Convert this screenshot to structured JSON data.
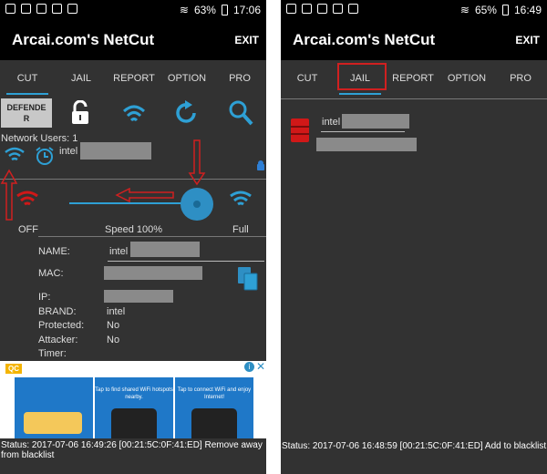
{
  "left": {
    "status_bar": {
      "battery": "63%",
      "time": "17:06"
    },
    "app_title": "Arcai.com's NetCut",
    "exit_label": "EXIT",
    "tabs": [
      "CUT",
      "JAIL",
      "REPORT",
      "OPTION",
      "PRO"
    ],
    "defender_label": "DEFENDER",
    "network_users": "Network Users: 1",
    "user_name": "intel",
    "speed": {
      "off": "OFF",
      "label": "Speed 100%",
      "full": "Full",
      "value_percent": 100
    },
    "details": {
      "name_label": "NAME:",
      "name_value": "intel",
      "mac_label": "MAC:",
      "ip_label": "IP:",
      "brand_label": "BRAND:",
      "brand_value": "intel",
      "protected_label": "Protected:",
      "protected_value": "No",
      "attacker_label": "Attacker:",
      "attacker_value": "No",
      "timer_label": "Timer:"
    },
    "ad": {
      "badge": "QC",
      "card1": "Tap to find shared WiFi hotspots nearby.",
      "card2": "Tap to connect WiFi and enjoy Internet!"
    },
    "status_message": "Status: 2017-07-06 16:49:26 [00:21:5C:0F:41:ED] Remove away from blacklist"
  },
  "right": {
    "status_bar": {
      "battery": "65%",
      "time": "16:49"
    },
    "app_title": "Arcai.com's NetCut",
    "exit_label": "EXIT",
    "tabs": [
      "CUT",
      "JAIL",
      "REPORT",
      "OPTION",
      "PRO"
    ],
    "jail_user": "intel",
    "status_message": "Status: 2017-07-06 16:48:59 [00:21:5C:0F:41:ED] Add to blacklist"
  },
  "colors": {
    "accent": "#2ea0d5",
    "annotation_red": "#d02020",
    "panel_bg": "#323232",
    "wifi_red": "#d01818"
  }
}
